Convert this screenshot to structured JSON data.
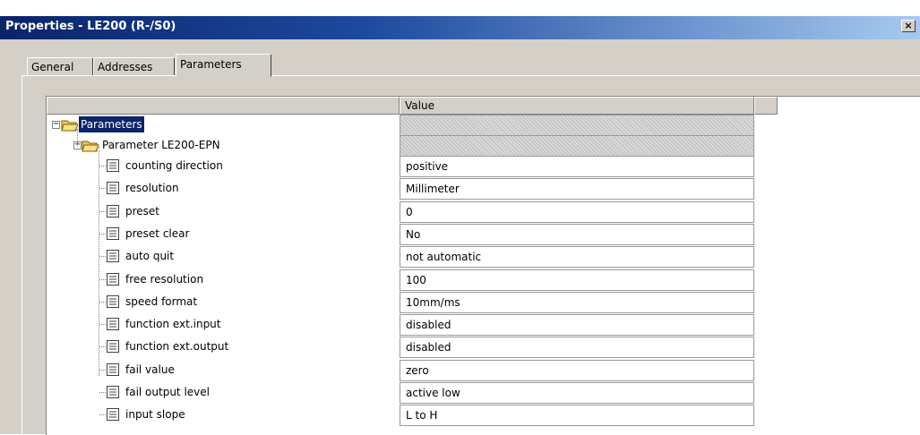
{
  "window": {
    "title": "Properties - LE200 (R-/S0)",
    "close_label": "×"
  },
  "tabs": [
    {
      "label": "General"
    },
    {
      "label": "Addresses"
    },
    {
      "label": "Parameters",
      "active": true
    }
  ],
  "tree": {
    "header": {
      "col1": "",
      "col2": "Value",
      "col3": ""
    },
    "root": {
      "label": "Parameters",
      "icon": "folder-open-icon",
      "expanded": true,
      "selected": true
    },
    "group": {
      "label": "Parameter LE200-EPN",
      "icon": "folder-open-icon",
      "expanded": true
    },
    "items": [
      {
        "label": "counting direction",
        "value": "positive",
        "icon": "document-icon"
      },
      {
        "label": "resolution",
        "value": "Millimeter",
        "icon": "document-icon"
      },
      {
        "label": "preset",
        "value": "0",
        "icon": "document-icon"
      },
      {
        "label": "preset clear",
        "value": "No",
        "icon": "document-icon"
      },
      {
        "label": "auto quit",
        "value": "not automatic",
        "icon": "document-icon"
      },
      {
        "label": "free resolution",
        "value": "100",
        "icon": "document-icon"
      },
      {
        "label": "speed format",
        "value": "10mm/ms",
        "icon": "document-icon"
      },
      {
        "label": "function ext.input",
        "value": "disabled",
        "icon": "document-icon"
      },
      {
        "label": "function ext.output",
        "value": "disabled",
        "icon": "document-icon"
      },
      {
        "label": "fail value",
        "value": "zero",
        "icon": "document-icon"
      },
      {
        "label": "fail output level",
        "value": "active low",
        "icon": "document-icon"
      },
      {
        "label": "input slope",
        "value": "L to H",
        "icon": "document-icon"
      }
    ]
  },
  "colors": {
    "titlebar_start": "#0a246a",
    "titlebar_end": "#a6caf0",
    "dialog_bg": "#d4d0c8",
    "selection": "#0a246a"
  }
}
